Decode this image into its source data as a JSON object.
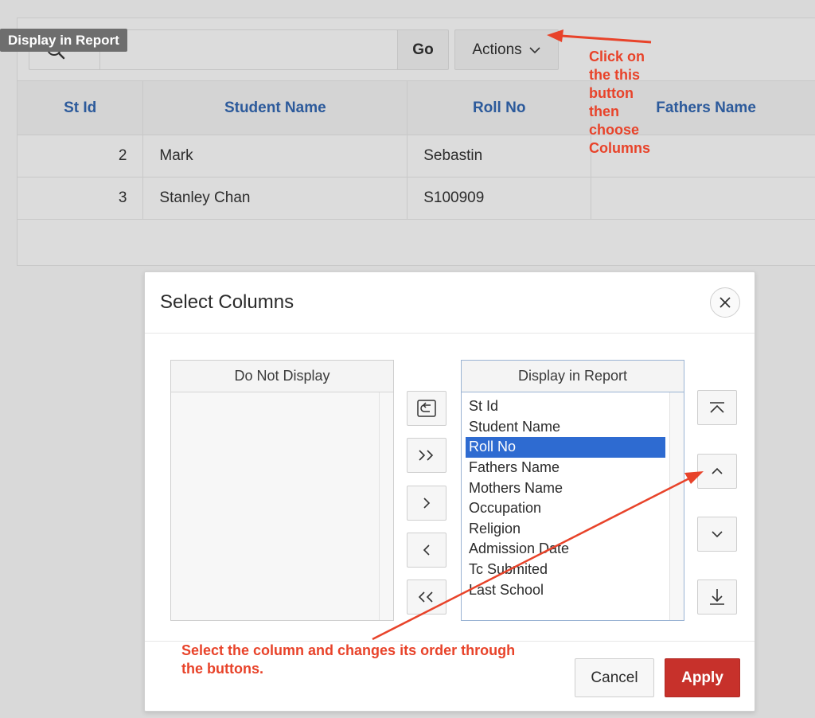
{
  "report": {
    "go_label": "Go",
    "actions_label": "Actions",
    "columns": [
      "St Id",
      "Student Name",
      "Roll No",
      "Fathers Name"
    ],
    "rows": [
      [
        "2",
        "Mark",
        "Sebastin",
        ""
      ],
      [
        "3",
        "Stanley Chan",
        "S100909",
        ""
      ]
    ],
    "tooltip": "Display in Report"
  },
  "annotations": {
    "top_lines": [
      "Click on",
      "the this",
      "button",
      "then",
      "choose",
      "Columns"
    ],
    "bottom_lines": [
      "Select the column and changes its order through",
      "the buttons."
    ],
    "color": "#e8432a"
  },
  "dialog": {
    "title": "Select Columns",
    "left_panel_title": "Do Not Display",
    "right_panel_title": "Display in Report",
    "display_columns": [
      "St Id",
      "Student Name",
      "Roll No",
      "Fathers Name",
      "Mothers Name",
      "Occupation",
      "Religion",
      "Admission Date",
      "Tc Submited",
      "Last School"
    ],
    "selected_column": "Roll No",
    "cancel_label": "Cancel",
    "apply_label": "Apply"
  },
  "colors": {
    "header_text": "#2c5a9b",
    "selection": "#2e6bd1",
    "apply": "#c7312b"
  },
  "icons": [
    "search-icon",
    "chevron-down-icon",
    "close-icon",
    "reset-icon",
    "move-all-right-icon",
    "move-right-icon",
    "move-left-icon",
    "move-all-left-icon",
    "move-top-icon",
    "move-up-icon",
    "move-down-icon",
    "move-bottom-icon"
  ]
}
